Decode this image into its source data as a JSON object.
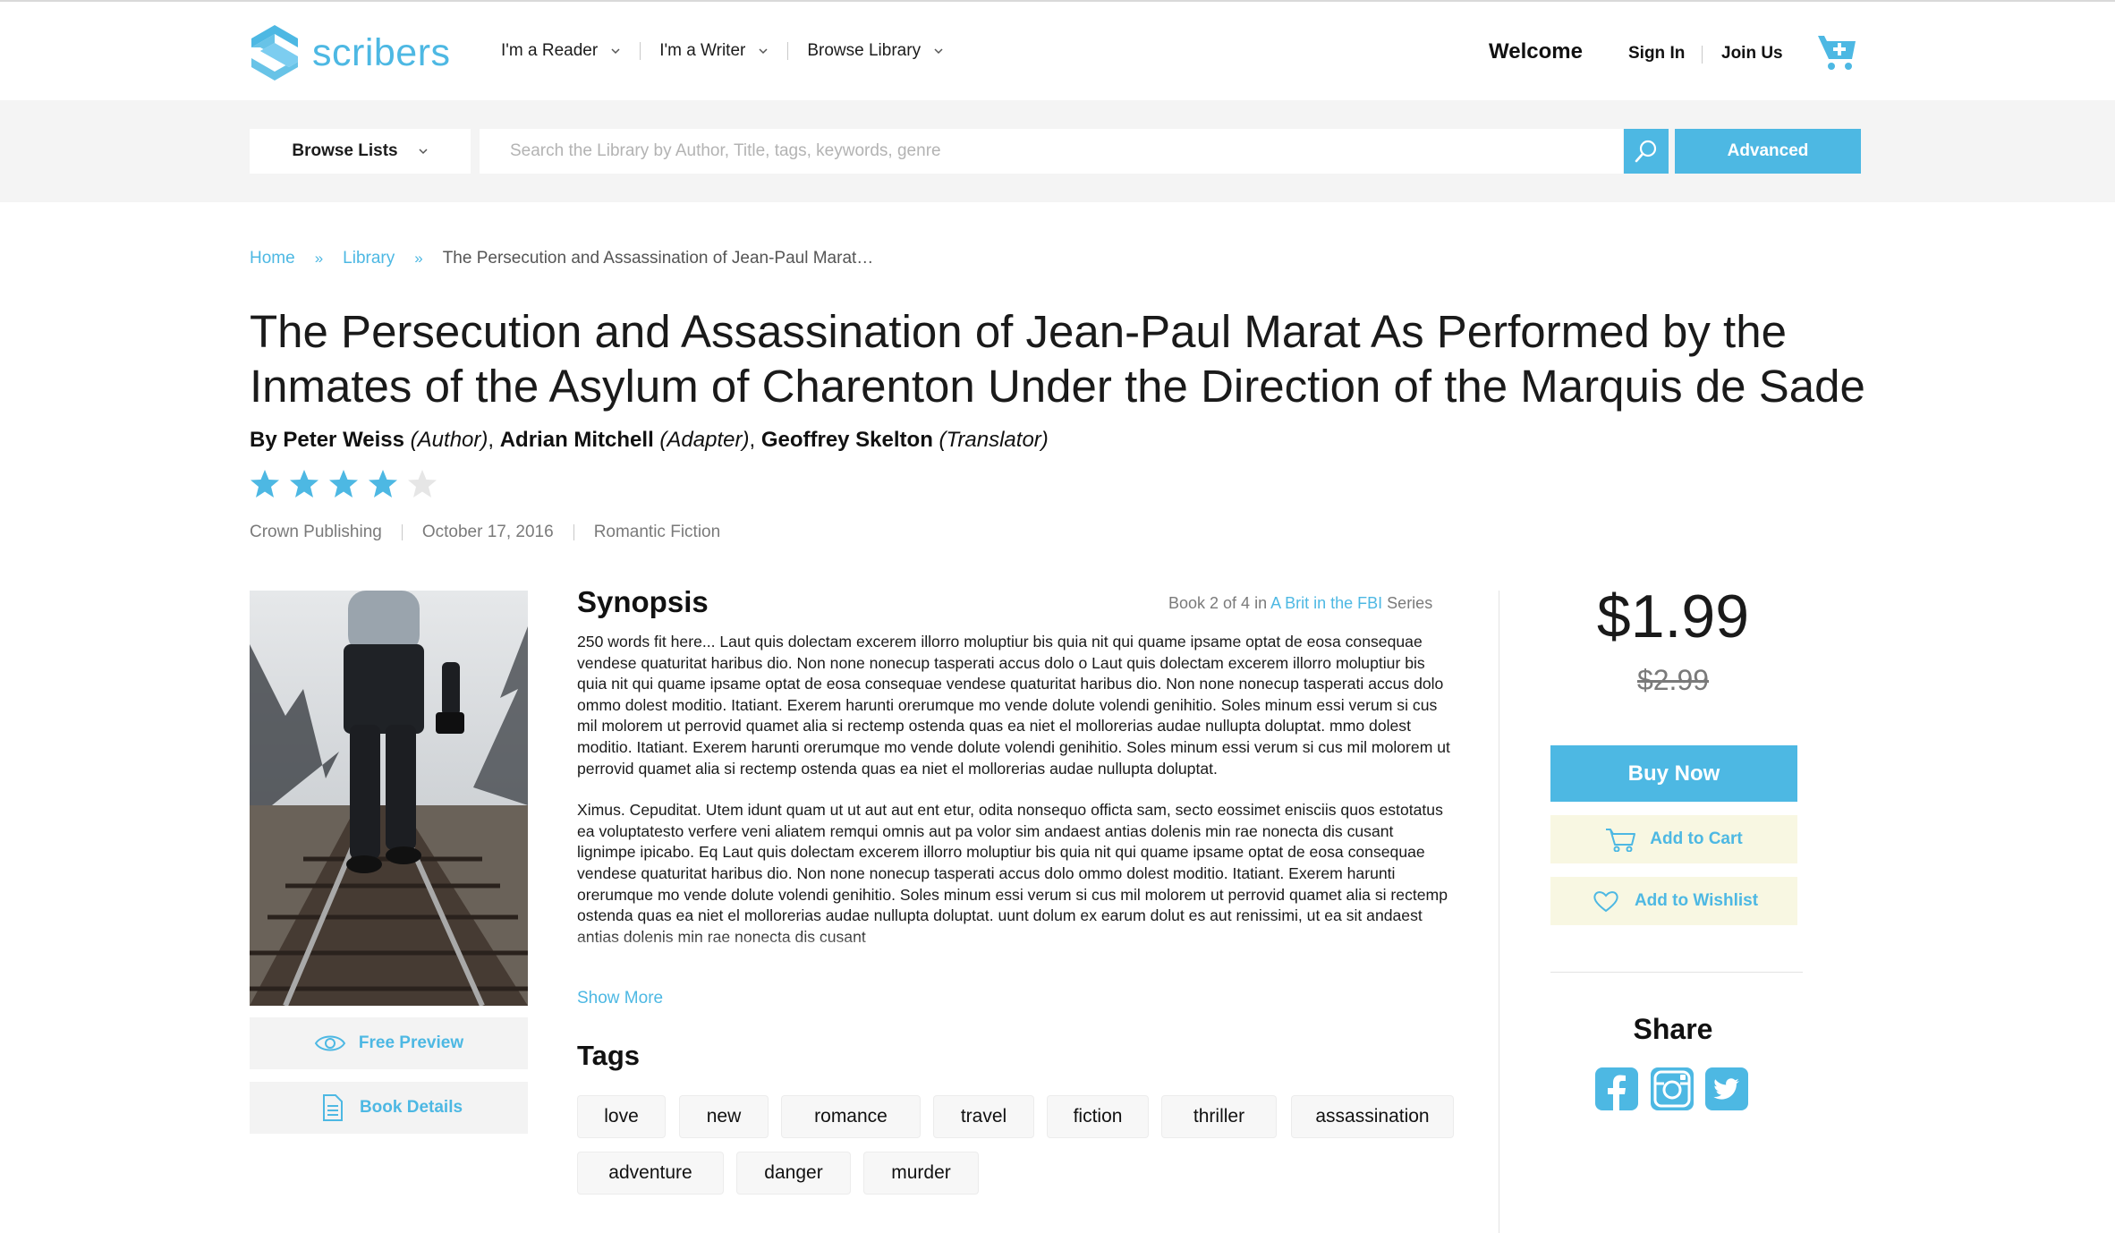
{
  "brand": {
    "name": "scribers",
    "accent": "#4db8e3"
  },
  "nav": {
    "items": [
      {
        "label": "I'm a Reader"
      },
      {
        "label": "I'm a Writer"
      },
      {
        "label": "Browse Library"
      }
    ],
    "welcome": "Welcome",
    "sign_in": "Sign In",
    "join_us": "Join Us",
    "cart_icon": "cart-plus-icon"
  },
  "search": {
    "browse_lists": "Browse Lists",
    "placeholder": "Search the Library by Author, Title, tags, keywords, genre",
    "value": "",
    "advanced": "Advanced"
  },
  "breadcrumb": {
    "home": "Home",
    "separator": "»",
    "library": "Library",
    "current": "The Persecution and Assassination of Jean-Paul Marat…"
  },
  "book": {
    "title": "The Persecution and Assassination of Jean-Paul Marat As Performed by the Inmates of the Asylum of Charenton Under the Direction of the Marquis de Sade",
    "by": "By",
    "contributors": [
      {
        "name": "Peter Weiss",
        "role": "(Author)"
      },
      {
        "name": "Adrian Mitchell",
        "role": "(Adapter)"
      },
      {
        "name": "Geoffrey Skelton",
        "role": "(Translator)"
      }
    ],
    "rating": 4,
    "rating_max": 5,
    "publisher": "Crown Publishing",
    "date": "October 17, 2016",
    "genre": "Romantic Fiction"
  },
  "cover": {
    "free_preview": "Free Preview",
    "book_details": "Book Details"
  },
  "synopsis": {
    "heading": "Synopsis",
    "series_prefix": "Book 2 of 4 in",
    "series_name": "A Brit in the FBI",
    "series_suffix": "Series",
    "paragraph_1": "250 words fit here... Laut quis dolectam excerem illorro moluptiur bis quia nit qui quame ipsame optat de eosa consequae vendese quaturitat haribus dio. Non none nonecup tasperati accus dolo o Laut quis dolectam excerem illorro moluptiur bis quia nit qui quame ipsame optat de eosa consequae vendese quaturitat haribus dio. Non none nonecup tasperati accus dolo ommo dolest moditio. Itatiant. Exerem harunti orerumque mo vende dolute volendi genihitio. Soles minum essi verum si cus mil molorem ut perrovid quamet alia si rectemp ostenda quas ea niet el mollorerias audae nullupta doluptat. mmo dolest moditio. Itatiant. Exerem harunti orerumque mo vende dolute volendi genihitio. Soles minum essi verum si cus mil molorem ut perrovid quamet alia si rectemp ostenda quas ea niet el mollorerias audae nullupta doluptat.",
    "paragraph_2": "Ximus. Cepuditat. Utem idunt quam ut ut aut aut ent etur, odita nonsequo officta sam, secto eossimet enisciis quos estotatus ea voluptatesto verfere veni aliatem remqui omnis aut pa volor sim andaest antias dolenis min rae nonecta dis cusant lignimpe ipicabo. Eq Laut quis dolectam excerem illorro moluptiur bis quia nit qui quame ipsame optat de eosa consequae vendese quaturitat haribus dio. Non none nonecup tasperati accus dolo ommo dolest moditio. Itatiant. Exerem harunti orerumque mo vende dolute volendi genihitio. Soles minum essi verum si cus mil molorem ut perrovid quamet alia si rectemp ostenda quas ea niet el mollorerias audae nullupta doluptat. uunt dolum ex earum dolut es aut renissimi, ut ea sit andaest antias dolenis min rae nonecta dis cusant",
    "show_more": "Show More"
  },
  "tags": {
    "heading": "Tags",
    "items": [
      "love",
      "new",
      "romance",
      "travel",
      "fiction",
      "thriller",
      "assassination",
      "adventure",
      "danger",
      "murder"
    ]
  },
  "purchase": {
    "price": "$1.99",
    "old_price": "$2.99",
    "buy_now": "Buy Now",
    "add_to_cart": "Add to Cart",
    "add_to_wishlist": "Add to Wishlist"
  },
  "share": {
    "heading": "Share",
    "networks": [
      "facebook-icon",
      "instagram-icon",
      "twitter-icon"
    ]
  }
}
